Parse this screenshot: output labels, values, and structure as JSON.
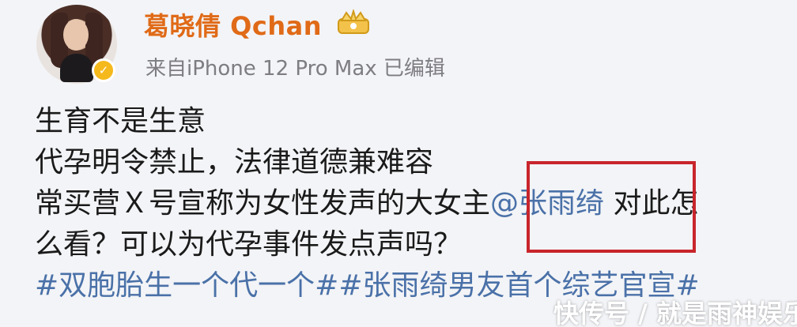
{
  "post": {
    "username": "葛晓倩 Qchan",
    "source": "来自iPhone 12 Pro Max  已编辑",
    "lines": {
      "l1": "生育不是生意",
      "l2": "代孕明令禁止，法律道德兼难容",
      "l3_pre": "常买营Ｘ号宣称为女性发声的大女主",
      "l3_mention": "@张雨绮",
      "l3_post": " 对此怎",
      "l4": "么看？可以为代孕事件发点声吗？",
      "l5": "#双胞胎生一个代一个##张雨绮男友首个综艺官宣#"
    }
  },
  "colors": {
    "username": "#e06a17",
    "link": "#4a71a8",
    "highlight": "#c8252c",
    "verified": "#f5b91c"
  },
  "icons": {
    "verified": "verified-badge-icon",
    "crown": "crown-badge-icon"
  },
  "watermark": "快传号 / 就是雨神娱乐"
}
